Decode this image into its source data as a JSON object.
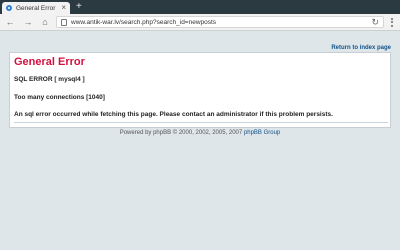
{
  "browser": {
    "tab": {
      "title": "General Error",
      "close_glyph": "×",
      "favicon": "site-favicon-icon"
    },
    "new_tab_glyph": "+",
    "url": "www.antik-war.lv/search.php?search_id=newposts",
    "icons": {
      "back": "back-arrow-icon",
      "forward": "forward-arrow-icon",
      "home": "home-icon",
      "reload": "reload-icon",
      "menu": "menu-dots-icon",
      "page": "page-icon"
    },
    "glyphs": {
      "back": "←",
      "forward": "→",
      "home": "⌂",
      "reload": "↻"
    }
  },
  "page": {
    "return_link": "Return to index page",
    "error_title": "General Error",
    "messages": [
      "SQL ERROR [ mysql4 ]",
      "Too many connections [1040]",
      "An sql error occurred while fetching this page. Please contact an administrator if this problem persists."
    ],
    "footer": {
      "prefix": "Powered by phpBB © 2000, 2002, 2005, 2007",
      "link": "phpBB Group"
    }
  },
  "colors": {
    "error_title": "#d31141",
    "link": "#105289",
    "page_bg": "#dfe6ea",
    "tab_strip": "#2b3a41"
  }
}
